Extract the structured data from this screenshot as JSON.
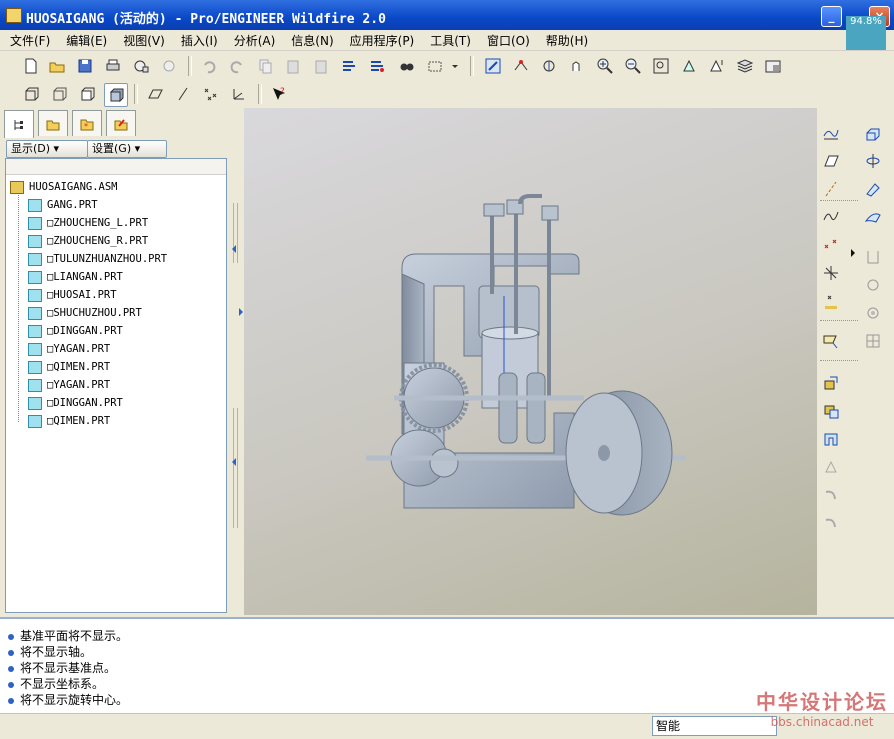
{
  "window": {
    "title": "HUOSAIGANG (活动的) - Pro/ENGINEER Wildfire 2.0",
    "zoom_badge": "94.8%"
  },
  "menu": [
    "文件(F)",
    "编辑(E)",
    "视图(V)",
    "插入(I)",
    "分析(A)",
    "信息(N)",
    "应用程序(P)",
    "工具(T)",
    "窗口(O)",
    "帮助(H)"
  ],
  "navigator": {
    "show_button": "显示(D) ▾",
    "settings_button": "设置(G) ▾",
    "tree": [
      {
        "label": "HUOSAIGANG.ASM"
      },
      {
        "label": "GANG.PRT"
      },
      {
        "label": "□ZHOUCHENG_L.PRT"
      },
      {
        "label": "□ZHOUCHENG_R.PRT"
      },
      {
        "label": "□TULUNZHUANZHOU.PRT"
      },
      {
        "label": "□LIANGAN.PRT"
      },
      {
        "label": "□HUOSAI.PRT"
      },
      {
        "label": "□SHUCHUZHOU.PRT"
      },
      {
        "label": "□DINGGAN.PRT"
      },
      {
        "label": "□YAGAN.PRT"
      },
      {
        "label": "□QIMEN.PRT"
      },
      {
        "label": "□YAGAN.PRT"
      },
      {
        "label": "□DINGGAN.PRT"
      },
      {
        "label": "□QIMEN.PRT"
      }
    ]
  },
  "messages": [
    "基准平面将不显示。",
    "将不显示轴。",
    "将不显示基准点。",
    "不显示坐标系。",
    "将不显示旋转中心。"
  ],
  "status": {
    "filter_value": "智能"
  },
  "watermark": {
    "line1": "中华设计论坛",
    "line2": "bbs.chinacad.net"
  },
  "colors": {
    "titlebar": "#0a48c8",
    "model": "#a9b4c2",
    "viewport_bg": "#cdcbc5"
  }
}
